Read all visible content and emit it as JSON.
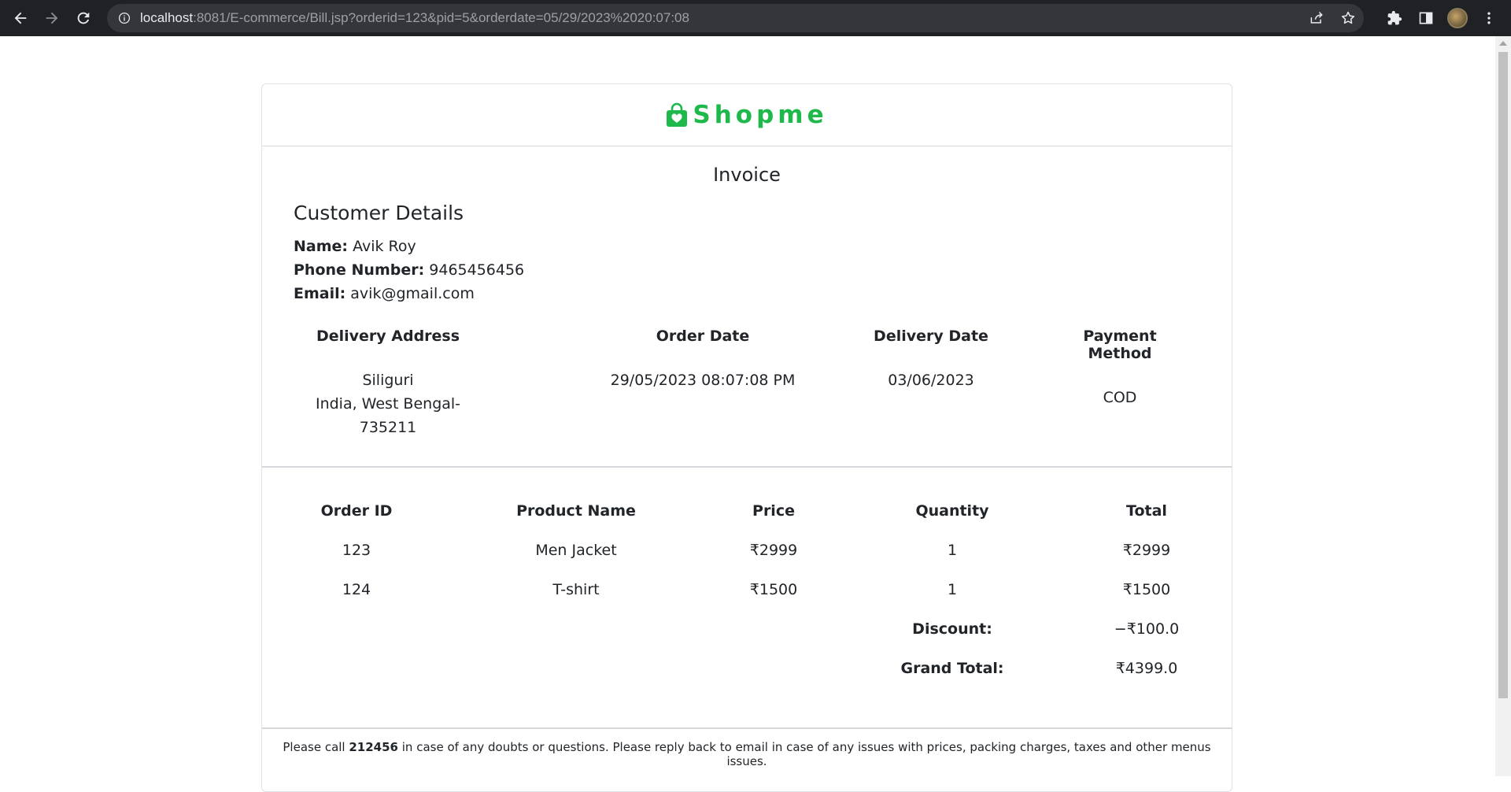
{
  "browser": {
    "url_host": "localhost",
    "url_path": ":8081/E-commerce/Bill.jsp?orderid=123&pid=5&orderdate=05/29/2023%2020:07:08"
  },
  "brand": {
    "name": "Shopme",
    "color": "#1fb84b"
  },
  "invoice": {
    "title": "Invoice",
    "customer_heading": "Customer Details",
    "name_label": "Name:",
    "name": "Avik Roy",
    "phone_label": "Phone Number:",
    "phone": "9465456456",
    "email_label": "Email:",
    "email": "avik@gmail.com"
  },
  "delivery_info": {
    "headers": [
      "Delivery Address",
      "Order Date",
      "Delivery Date",
      "Payment Method"
    ],
    "address_line1": "Siliguri",
    "address_line2": "India, West Bengal- 735211",
    "order_date": "29/05/2023 08:07:08 PM",
    "delivery_date": "03/06/2023",
    "payment_method": "COD"
  },
  "order_table": {
    "headers": [
      "Order ID",
      "Product Name",
      "Price",
      "Quantity",
      "Total"
    ],
    "rows": [
      [
        "123",
        "Men Jacket",
        "₹2999",
        "1",
        "₹2999"
      ],
      [
        "124",
        "T-shirt",
        "₹1500",
        "1",
        "₹1500"
      ]
    ],
    "discount_label": "Discount:",
    "discount_value": "−₹100.0",
    "grand_total_label": "Grand Total:",
    "grand_total_value": "₹4399.0"
  },
  "footer": {
    "pre": "Please call ",
    "phone": "212456",
    "post": " in case of any doubts or questions. Please reply back to email in case of any issues with prices, packing charges, taxes and other menus issues."
  }
}
